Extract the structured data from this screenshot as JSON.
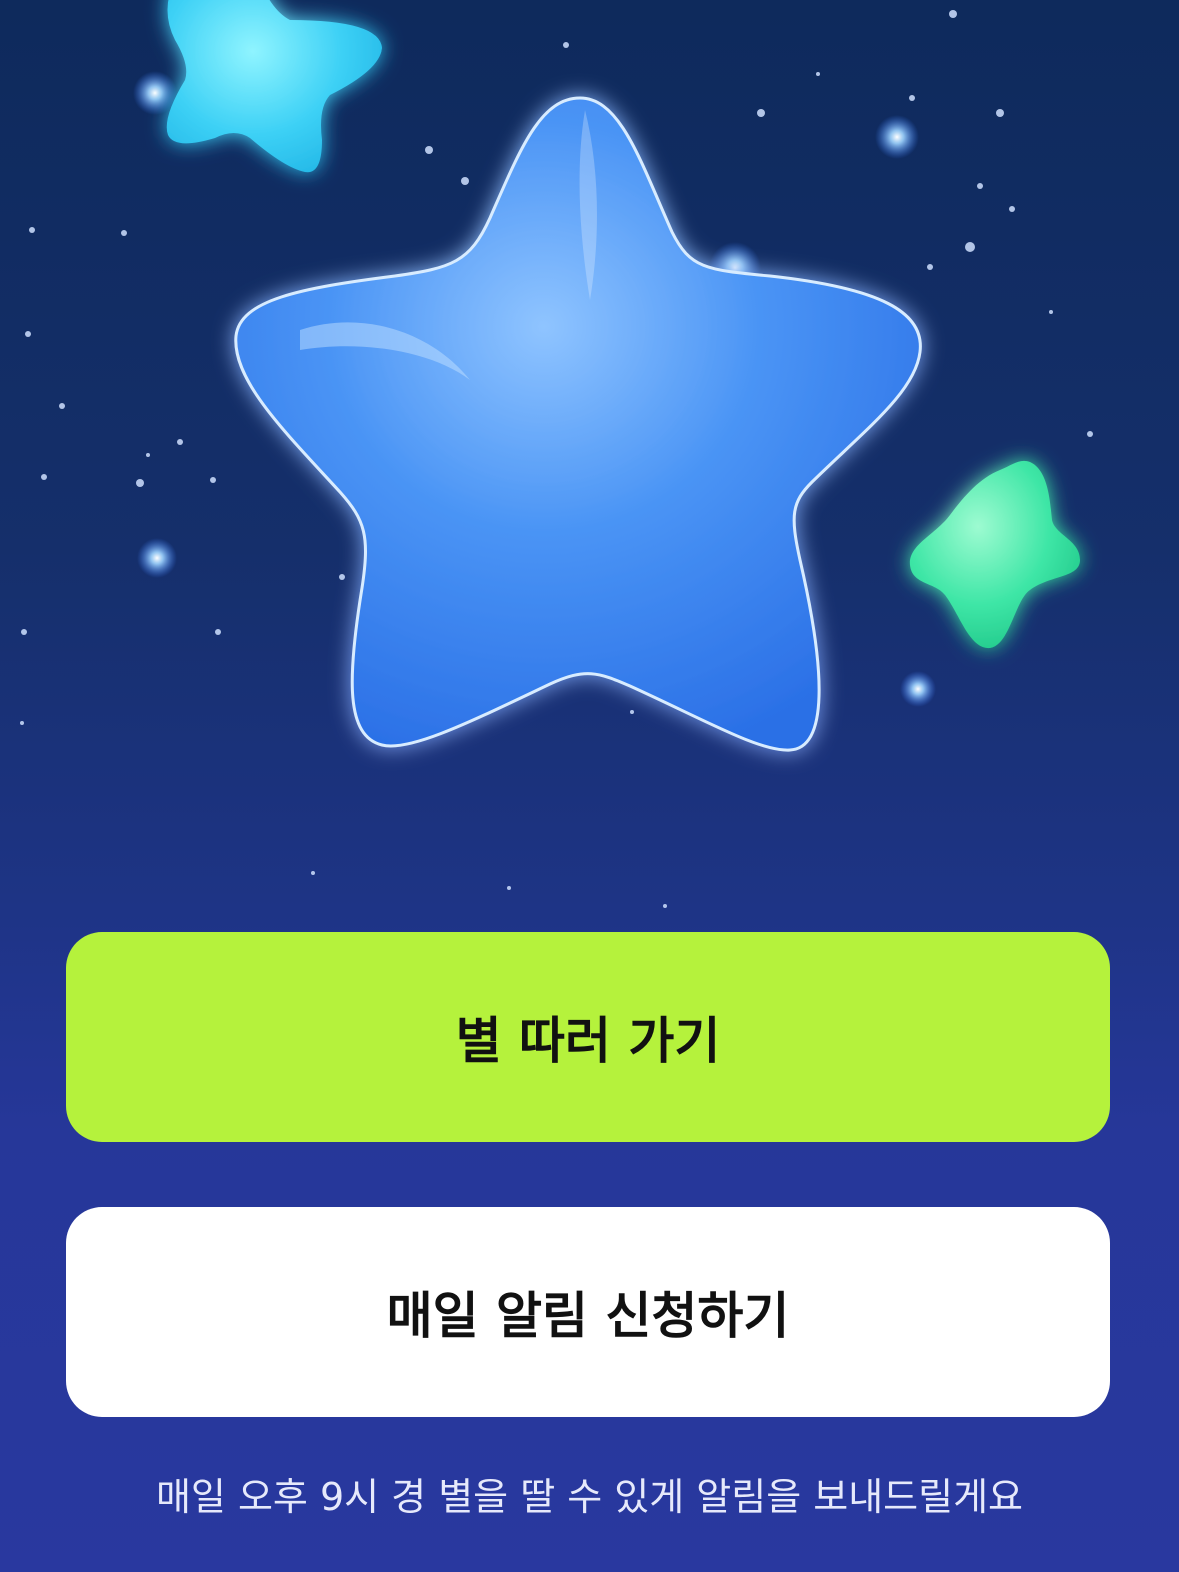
{
  "buttons": {
    "primary_label": "별 따러 가기",
    "secondary_label": "매일 알림 신청하기"
  },
  "footnote": "매일 오후 9시 경 별을 딸 수 있게 알림을 보내드릴게요",
  "colors": {
    "primary_button": "#b5f23c",
    "secondary_button": "#ffffff",
    "background_top": "#0e2a5c",
    "background_bottom": "#29389f",
    "main_star": "#4a8ef0",
    "small_star_cyan": "#35c8f0",
    "small_star_green": "#3ee6a6"
  },
  "icons": {
    "main": "star-icon",
    "decor_1": "star-icon",
    "decor_2": "star-icon"
  }
}
